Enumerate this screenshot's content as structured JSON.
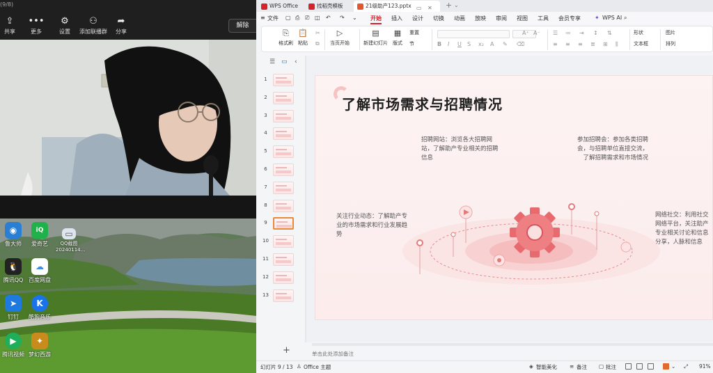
{
  "meeting": {
    "top_label": "(9/8)",
    "toolbar": [
      {
        "icon": "share-icon",
        "glyph": "⇪",
        "label": "共享"
      },
      {
        "icon": "more-icon",
        "glyph": "•••",
        "label": "更多"
      },
      {
        "icon": "gear-icon",
        "glyph": "⚙",
        "label": "设置"
      },
      {
        "icon": "add-group-icon",
        "glyph": "⚇",
        "label": "添加联播群"
      },
      {
        "icon": "share-arrow-icon",
        "glyph": "➦",
        "label": "分享"
      }
    ],
    "unmute_label": "解除"
  },
  "desktop": {
    "icons": [
      {
        "name": "desktop-icon-helper",
        "label": "鲁大师",
        "glyph": "◉",
        "color": "#2a7fd4"
      },
      {
        "name": "desktop-icon-iqiyi",
        "label": "爱奇艺",
        "glyph": "iQ",
        "color": "#21b14a"
      },
      {
        "name": "desktop-icon-qq-image",
        "label": "QQ截图\n20240114...",
        "glyph": "▭",
        "color": "#dde6ee"
      },
      {
        "name": "desktop-icon-tencent-qq",
        "label": "腾讯QQ",
        "glyph": "🐧",
        "color": "#222222"
      },
      {
        "name": "desktop-icon-baidu-netdisk",
        "label": "百度网盘",
        "glyph": "☁",
        "color": "#3a8ee8"
      },
      {
        "name": "desktop-icon-dingtalk",
        "label": "钉钉",
        "glyph": "➤",
        "color": "#1f7ae0"
      },
      {
        "name": "desktop-icon-kugou",
        "label": "酷狗音乐",
        "glyph": "K",
        "color": "#1a73e8"
      },
      {
        "name": "desktop-icon-tencent-video",
        "label": "腾讯视频",
        "glyph": "▶",
        "color": "#1fae5a"
      },
      {
        "name": "desktop-icon-game",
        "label": "梦幻西游",
        "glyph": "✦",
        "color": "#c98b1c"
      }
    ]
  },
  "wps": {
    "tabs": [
      {
        "name": "tab-wps-office",
        "label": "WPS Office",
        "color": "#d6232b"
      },
      {
        "name": "tab-template",
        "label": "找稻壳模板",
        "color": "#d6232b"
      },
      {
        "name": "tab-document",
        "label": "21级助产123.pptx",
        "color": "#e4572e"
      }
    ],
    "menu": [
      {
        "name": "menu-file",
        "label": "文件"
      },
      {
        "name": "menu-start",
        "label": "开始"
      },
      {
        "name": "menu-insert",
        "label": "插入"
      },
      {
        "name": "menu-design",
        "label": "设计"
      },
      {
        "name": "menu-transition",
        "label": "切换"
      },
      {
        "name": "menu-animation",
        "label": "动画"
      },
      {
        "name": "menu-slideshow",
        "label": "放映"
      },
      {
        "name": "menu-review",
        "label": "审阅"
      },
      {
        "name": "menu-view",
        "label": "视图"
      },
      {
        "name": "menu-tools",
        "label": "工具"
      },
      {
        "name": "menu-member",
        "label": "会员专享"
      },
      {
        "name": "menu-wps-ai",
        "label": "WPS AI"
      }
    ],
    "ribbon": {
      "format_painter": "格式刷",
      "paste": "粘贴",
      "play_from_current": "当页开始",
      "new_slide": "新建幻灯片",
      "layout": "版式",
      "section": "节",
      "reset": "重置",
      "arrange": "排列",
      "textbox": "文本框",
      "shape": "形状",
      "picture": "图片"
    },
    "slides": {
      "count": 13,
      "selected": 9
    },
    "slide": {
      "title": "了解市场需求与招聘情况",
      "blocks": [
        {
          "name": "text-recruitment-sites",
          "text": "招聘网站：浏览各大招聘网站，了解助产专业相关的招聘信息"
        },
        {
          "name": "text-job-fairs",
          "text": "参加招聘会：参加各类招聘会，与招聘单位直接交流，了解招聘需求和市场情况"
        },
        {
          "name": "text-industry-trends",
          "text": "关注行业动态：了解助产专业的市场需求和行业发展趋势"
        },
        {
          "name": "text-social-network",
          "text": "网络社交：利用社交网络平台，关注助产专业相关讨论和信息分享，人脉和信息"
        }
      ]
    },
    "notes_placeholder": "单击此处添加备注",
    "status": {
      "slide_indicator": "幻灯片 9 / 13",
      "theme": "Office 主题",
      "smart_beautify": "智能美化",
      "notes": "备注",
      "comments": "批注",
      "zoom": "91%"
    },
    "accent_color": "#d6232b"
  }
}
